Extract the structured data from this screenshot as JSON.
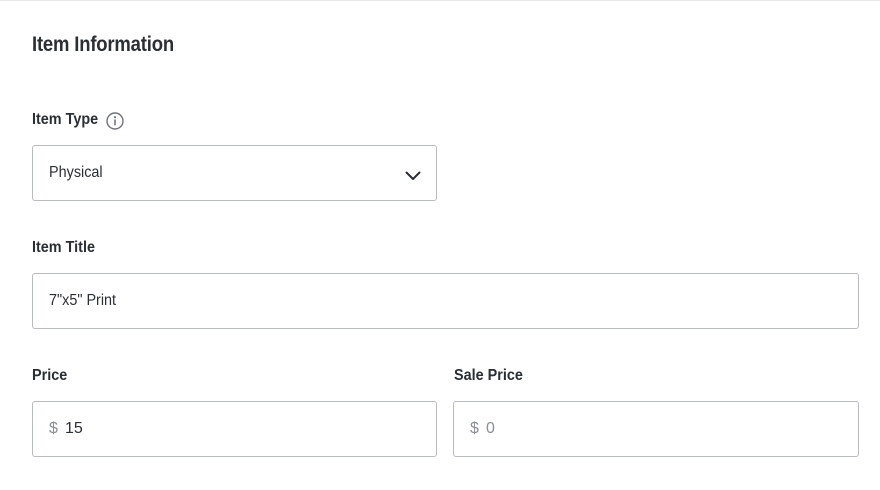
{
  "section": {
    "title": "Item Information"
  },
  "item_type": {
    "label": "Item Type",
    "info_icon": "info-icon",
    "selected_value": "Physical",
    "dropdown_icon": "chevron-down-icon"
  },
  "item_title": {
    "label": "Item Title",
    "value": "7\"x5\" Print"
  },
  "price": {
    "label": "Price",
    "currency_symbol": "$",
    "value": "15"
  },
  "sale_price": {
    "label": "Sale Price",
    "currency_symbol": "$",
    "placeholder": "0"
  },
  "colors": {
    "text": "#2b2f33",
    "border": "#b8bcc0",
    "muted": "#8a8f94"
  }
}
